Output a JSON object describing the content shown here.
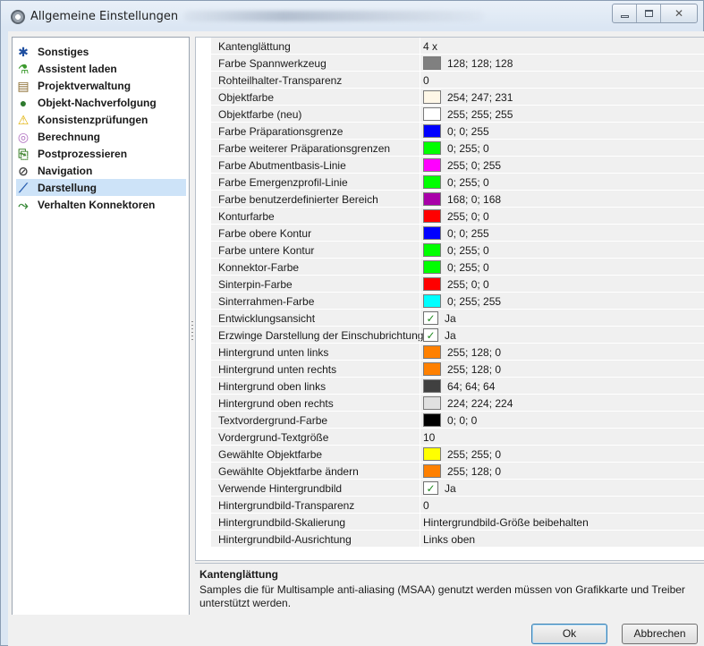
{
  "window": {
    "title": "Allgemeine Einstellungen",
    "controls": {
      "minimize": "minimize-icon",
      "maximize": "maximize-icon",
      "close": "close-icon"
    }
  },
  "sidebar": {
    "selected": "Darstellung",
    "items": [
      {
        "label": "Sonstiges",
        "icon": "asterisk-icon",
        "color": "#1f4fa0"
      },
      {
        "label": "Assistent laden",
        "icon": "wand-icon",
        "color": "#3c9a2e"
      },
      {
        "label": "Projektverwaltung",
        "icon": "organizer-icon",
        "color": "#8a6b2e"
      },
      {
        "label": "Objekt-Nachverfolgung",
        "icon": "globe-icon",
        "color": "#2e7a2e"
      },
      {
        "label": "Konsistenzprüfungen",
        "icon": "warning-icon",
        "color": "#e0b000"
      },
      {
        "label": "Berechnung",
        "icon": "stack-icon",
        "color": "#b06fc0"
      },
      {
        "label": "Postprozessieren",
        "icon": "process-icon",
        "color": "#4a8a3a"
      },
      {
        "label": "Navigation",
        "icon": "compass-icon",
        "color": "#444444"
      },
      {
        "label": "Darstellung",
        "icon": "brush-icon",
        "color": "#2a5fb0"
      },
      {
        "label": "Verhalten Konnektoren",
        "icon": "connector-icon",
        "color": "#3a8a3a"
      }
    ]
  },
  "properties": [
    {
      "name": "Kantenglättung",
      "value": "4 x"
    },
    {
      "name": "Farbe Spannwerkzeug",
      "value": "128; 128; 128",
      "color": "#808080"
    },
    {
      "name": "Rohteilhalter-Transparenz",
      "value": "0"
    },
    {
      "name": "Objektfarbe",
      "value": "254; 247; 231",
      "color": "#fef7e7"
    },
    {
      "name": "Objektfarbe (neu)",
      "value": "255; 255; 255",
      "color": "#ffffff"
    },
    {
      "name": "Farbe Präparationsgrenze",
      "value": "0; 0; 255",
      "color": "#0000ff"
    },
    {
      "name": "Farbe weiterer Präparationsgrenzen",
      "value": "0; 255; 0",
      "color": "#00ff00"
    },
    {
      "name": "Farbe Abutmentbasis-Linie",
      "value": "255; 0; 255",
      "color": "#ff00ff"
    },
    {
      "name": "Farbe Emergenzprofil-Linie",
      "value": "0; 255; 0",
      "color": "#00ff00"
    },
    {
      "name": "Farbe benutzerdefinierter Bereich",
      "value": "168; 0; 168",
      "color": "#a800a8"
    },
    {
      "name": "Konturfarbe",
      "value": "255; 0; 0",
      "color": "#ff0000"
    },
    {
      "name": "Farbe obere Kontur",
      "value": "0; 0; 255",
      "color": "#0000ff"
    },
    {
      "name": "Farbe untere Kontur",
      "value": "0; 255; 0",
      "color": "#00ff00"
    },
    {
      "name": "Konnektor-Farbe",
      "value": "0; 255; 0",
      "color": "#00ff00"
    },
    {
      "name": "Sinterpin-Farbe",
      "value": "255; 0; 0",
      "color": "#ff0000"
    },
    {
      "name": "Sinterrahmen-Farbe",
      "value": "0; 255; 255",
      "color": "#00ffff"
    },
    {
      "name": "Entwicklungsansicht",
      "value": "Ja",
      "checked": true
    },
    {
      "name": "Erzwinge Darstellung der Einschubrichtung",
      "value": "Ja",
      "checked": true
    },
    {
      "name": "Hintergrund unten links",
      "value": "255; 128; 0",
      "color": "#ff8000"
    },
    {
      "name": "Hintergrund unten rechts",
      "value": "255; 128; 0",
      "color": "#ff8000"
    },
    {
      "name": "Hintergrund oben links",
      "value": "64; 64; 64",
      "color": "#404040"
    },
    {
      "name": "Hintergrund oben rechts",
      "value": "224; 224; 224",
      "color": "#e0e0e0"
    },
    {
      "name": "Textvordergrund-Farbe",
      "value": "0; 0; 0",
      "color": "#000000"
    },
    {
      "name": "Vordergrund-Textgröße",
      "value": "10"
    },
    {
      "name": "Gewählte Objektfarbe",
      "value": "255; 255; 0",
      "color": "#ffff00"
    },
    {
      "name": "Gewählte Objektfarbe ändern",
      "value": "255; 128; 0",
      "color": "#ff8000"
    },
    {
      "name": "Verwende Hintergrundbild",
      "value": "Ja",
      "checked": true
    },
    {
      "name": "Hintergrundbild-Transparenz",
      "value": "0"
    },
    {
      "name": "Hintergrundbild-Skalierung",
      "value": "Hintergrundbild-Größe beibehalten"
    },
    {
      "name": "Hintergrundbild-Ausrichtung",
      "value": "Links oben"
    }
  ],
  "description": {
    "title": "Kantenglättung",
    "text": "Samples die für Multisample anti-aliasing (MSAA) genutzt werden müssen von Grafikkarte und Treiber unterstützt werden."
  },
  "buttons": {
    "ok": "Ok",
    "cancel": "Abbrechen"
  }
}
